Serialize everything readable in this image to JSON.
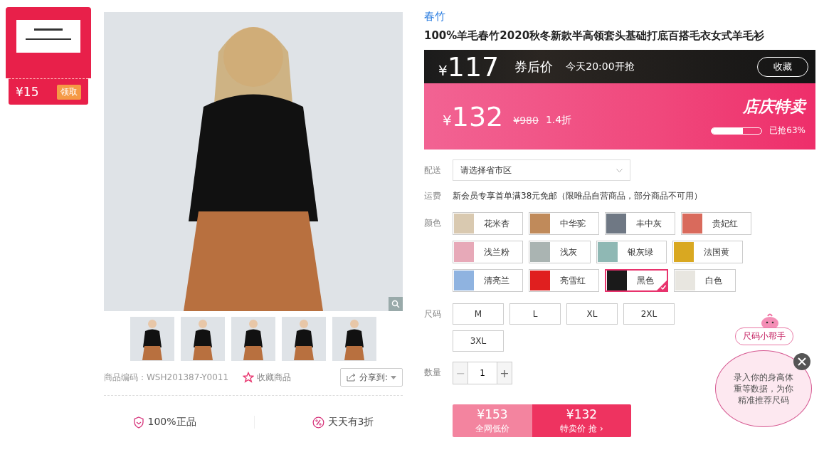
{
  "coupon": {
    "amount": "¥15",
    "action": "领取"
  },
  "gallery": {
    "thumbnails": [
      {
        "selected": false
      },
      {
        "selected": false
      },
      {
        "selected": false
      },
      {
        "selected": false
      },
      {
        "selected": false
      }
    ],
    "code_label": "商品编码：WSH201387-Y0011",
    "favorite": "收藏商品",
    "share": "分享到:",
    "guarantees": [
      {
        "kind": "shield",
        "text": "100%正品"
      },
      {
        "kind": "percent",
        "text": "天天有3折"
      }
    ]
  },
  "brand": "春竹",
  "title": "100%羊毛春竹2020秋冬新款半高领套头基础打底百搭毛衣女式羊毛衫",
  "promo": {
    "coupon_price": "117",
    "currency": "¥",
    "coupon_label": "券后价",
    "start_time": "今天20:00开抢",
    "collect": "收藏",
    "price": "132",
    "original_price": "¥980",
    "discount": "1.4折",
    "event": "店庆特卖",
    "sold": {
      "level": 0.63,
      "label": "已抢63%"
    }
  },
  "delivery": {
    "label": "配送",
    "placeholder": "请选择省市区"
  },
  "shipping": {
    "label": "运费",
    "text": "新会员专享首单满38元免邮（限唯品自营商品，部分商品不可用）"
  },
  "colors": {
    "label": "颜色",
    "options": [
      {
        "name": "花米杏",
        "color": "#d9c9b0",
        "selected": false
      },
      {
        "name": "中华驼",
        "color": "#c08a5a",
        "selected": false
      },
      {
        "name": "丰中灰",
        "color": "#6f7884",
        "selected": false
      },
      {
        "name": "贵妃红",
        "color": "#d96a5c",
        "selected": false
      },
      {
        "name": "浅兰粉",
        "color": "#e7a9b8",
        "selected": false
      },
      {
        "name": "浅灰",
        "color": "#aab4b2",
        "selected": false
      },
      {
        "name": "银灰绿",
        "color": "#8fb8b4",
        "selected": false
      },
      {
        "name": "法国黄",
        "color": "#d9a821",
        "selected": false
      },
      {
        "name": "清亮兰",
        "color": "#8fb3e0",
        "selected": false
      },
      {
        "name": "亮雪红",
        "color": "#e01f1f",
        "selected": false
      },
      {
        "name": "黑色",
        "color": "#1a1a1a",
        "selected": true
      },
      {
        "name": "白色",
        "color": "#e8e6e0",
        "selected": false
      }
    ]
  },
  "sizes": {
    "label": "尺码",
    "options": [
      {
        "name": "M",
        "selected": false
      },
      {
        "name": "L",
        "selected": false
      },
      {
        "name": "XL",
        "selected": false
      },
      {
        "name": "2XL",
        "selected": false
      },
      {
        "name": "3XL",
        "selected": false
      }
    ]
  },
  "quantity": {
    "label": "数量",
    "minus": "−",
    "value": "1",
    "plus": "+"
  },
  "buy": {
    "market_price": "¥153",
    "market_label": "全网低价",
    "sale_price": "¥132",
    "sale_label": "特卖价 抢",
    "sale_arrow": "›"
  },
  "size_helper": {
    "title": "尺码小帮手",
    "text": "录入你的身高体重等数据，为你精准推荐尺码"
  }
}
